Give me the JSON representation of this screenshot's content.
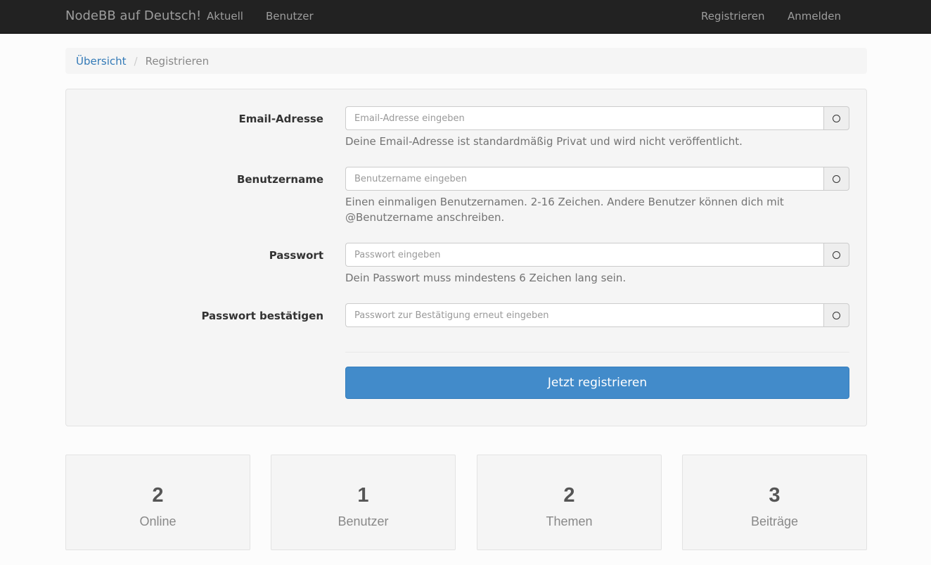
{
  "navbar": {
    "brand": "NodeBB auf Deutsch!",
    "links": [
      {
        "label": "Aktuell"
      },
      {
        "label": "Benutzer"
      }
    ],
    "right_links": [
      {
        "label": "Registrieren"
      },
      {
        "label": "Anmelden"
      }
    ]
  },
  "breadcrumb": {
    "home": "Übersicht",
    "separator": "/",
    "current": "Registrieren"
  },
  "form": {
    "fields": [
      {
        "label": "Email-Adresse",
        "value": "",
        "placeholder": "Email-Adresse eingeben",
        "help": "Deine Email-Adresse ist standardmäßig Privat und wird nicht veröffentlicht.",
        "addon_icon": "circle-icon"
      },
      {
        "label": "Benutzername",
        "value": "",
        "placeholder": "Benutzername eingeben",
        "help": "Einen einmaligen Benutzernamen. 2-16 Zeichen. Andere Benutzer können dich mit @Benutzername anschreiben.",
        "addon_icon": "circle-icon"
      },
      {
        "label": "Passwort",
        "value": "",
        "placeholder": "Passwort eingeben",
        "help": "Dein Passwort muss mindestens 6 Zeichen lang sein.",
        "addon_icon": "circle-icon"
      },
      {
        "label": "Passwort bestätigen",
        "value": "",
        "placeholder": "Passwort zur Bestätigung erneut eingeben",
        "addon_icon": "circle-icon"
      }
    ],
    "submit_label": "Jetzt registrieren"
  },
  "stats": [
    {
      "value": "2",
      "label": "Online"
    },
    {
      "value": "1",
      "label": "Benutzer"
    },
    {
      "value": "2",
      "label": "Themen"
    },
    {
      "value": "3",
      "label": "Beiträge"
    }
  ],
  "colors": {
    "navbar_bg": "#222222",
    "link": "#337ab7",
    "primary_button": "#428bca",
    "panel_bg": "#f5f5f5"
  }
}
